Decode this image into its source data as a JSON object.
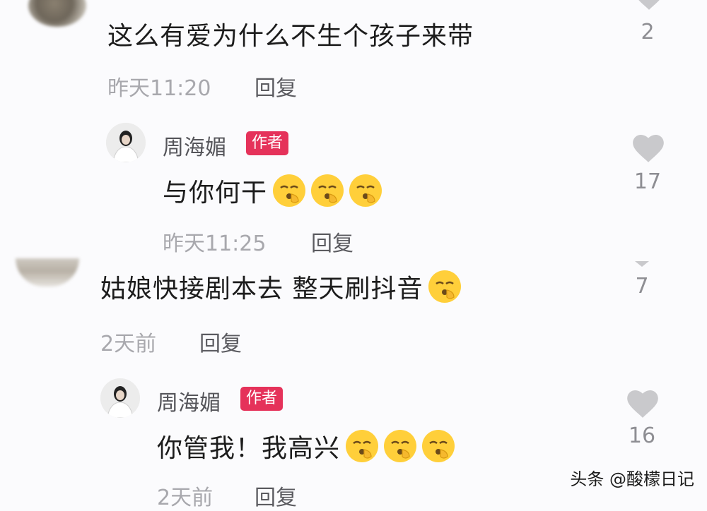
{
  "comments": [
    {
      "text": "这么有爱为什么不生个孩子来带",
      "time": "昨天11:20",
      "reply_label": "回复",
      "likes": "2"
    },
    {
      "author": "周海媚",
      "badge": "作者",
      "text": "与你何干",
      "time": "昨天11:25",
      "reply_label": "回复",
      "likes": "17",
      "emoji_count": 3
    },
    {
      "text": "姑娘快接剧本去 整天刷抖音",
      "time": "2天前",
      "reply_label": "回复",
      "likes": "7",
      "emoji_count": 1
    },
    {
      "author": "周海媚",
      "badge": "作者",
      "text": "你管我！我高兴",
      "time": "2天前",
      "reply_label": "回复",
      "likes": "16",
      "emoji_count": 3
    }
  ],
  "watermark": "头条 @酸檬日记",
  "icons": {
    "like": "heart-icon",
    "emoji": "shushing-face-emoji"
  },
  "colors": {
    "badge": "#e5325a",
    "heart": "#c9c9cc"
  }
}
